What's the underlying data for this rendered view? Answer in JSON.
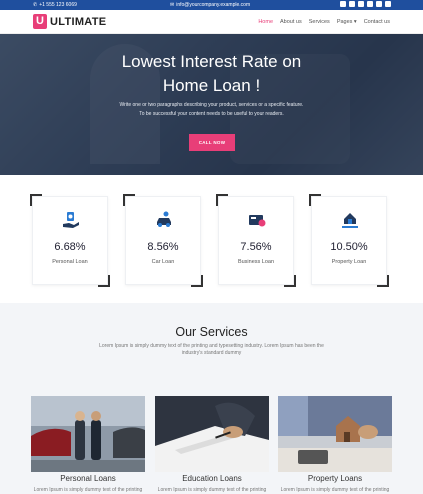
{
  "topbar": {
    "phone": "+1 555 123 6069",
    "email": "info@yourcompany.example.com",
    "social_icons": [
      "facebook-icon",
      "twitter-icon",
      "vimeo-icon",
      "linkedin-icon",
      "youtube-icon",
      "github-icon"
    ]
  },
  "brand": {
    "mark": "U",
    "name": "ULTIMATE",
    "accent": "#e83e78",
    "topbar_color": "#1f4f9e"
  },
  "menu": [
    {
      "label": "Home",
      "active": true
    },
    {
      "label": "About us"
    },
    {
      "label": "Services"
    },
    {
      "label": "Pages ▾"
    },
    {
      "label": "Contact us"
    }
  ],
  "hero": {
    "title_line1": "Lowest Interest Rate on",
    "title_line2": "Home Loan !",
    "text_line1": "Write one or two paragraphs describing your product, services or a specific feature.",
    "text_line2": "To be successful your content needs to be useful to your readers.",
    "cta": "CALL NOW"
  },
  "rates": [
    {
      "value": "6.68%",
      "label": "Personal Loan",
      "icon": "money-hand-icon"
    },
    {
      "value": "8.56%",
      "label": "Car Loan",
      "icon": "car-icon"
    },
    {
      "value": "7.56%",
      "label": "Business Loan",
      "icon": "business-card-icon"
    },
    {
      "value": "10.50%",
      "label": "Property Loan",
      "icon": "house-hand-icon"
    }
  ],
  "services": {
    "heading": "Our Services",
    "desc_line1": "Lorem Ipsum is simply dummy text of the printing and typesetting industry. Lorem Ipsum has been the",
    "desc_line2": "industry's standard dummy",
    "items": [
      {
        "title": "Personal Loans",
        "text": "Lorem Ipsum is simply dummy text of the printing"
      },
      {
        "title": "Education Loans",
        "text": "Lorem Ipsum is simply dummy text of the printing"
      },
      {
        "title": "Property Loans",
        "text": "Lorem Ipsum is simply dummy text of the printing"
      }
    ]
  }
}
